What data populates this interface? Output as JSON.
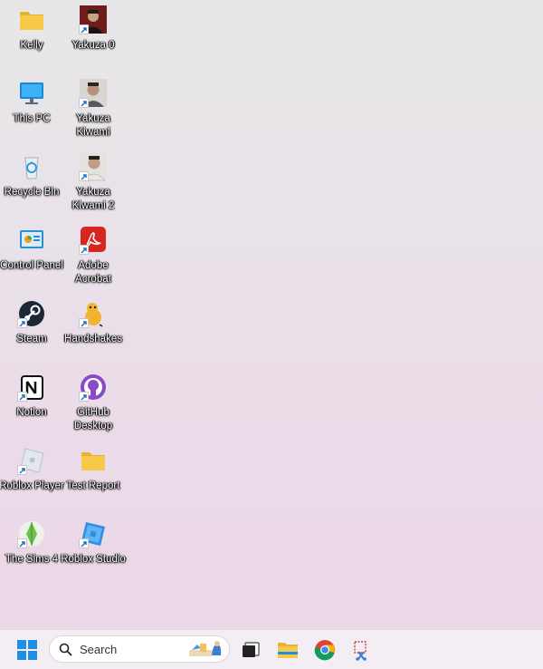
{
  "desktop": {
    "icons": [
      {
        "label": "Kelly",
        "icon": "folder-icon"
      },
      {
        "label": "Yakuza 0",
        "icon": "yakuza-0-icon"
      },
      {
        "label": "This PC",
        "icon": "monitor-icon"
      },
      {
        "label": "Yakuza Kiwami",
        "icon": "yakuza-kiwami-icon"
      },
      {
        "label": "Recycle Bin",
        "icon": "recycle-bin-icon"
      },
      {
        "label": "Yakuza Kiwami 2",
        "icon": "yakuza-kiwami-2-icon"
      },
      {
        "label": "Control Panel",
        "icon": "control-panel-icon"
      },
      {
        "label": "Adobe Acrobat",
        "icon": "adobe-acrobat-icon"
      },
      {
        "label": "Steam",
        "icon": "steam-icon"
      },
      {
        "label": "Handshakes",
        "icon": "handshakes-icon"
      },
      {
        "label": "Notion",
        "icon": "notion-icon"
      },
      {
        "label": "GitHub Desktop",
        "icon": "github-desktop-icon"
      },
      {
        "label": "Roblox Player",
        "icon": "roblox-player-icon"
      },
      {
        "label": "Test Report",
        "icon": "folder-icon"
      },
      {
        "label": "The Sims 4",
        "icon": "sims-4-icon"
      },
      {
        "label": "Roblox Studio",
        "icon": "roblox-studio-icon"
      }
    ]
  },
  "taskbar": {
    "search_placeholder": "Search",
    "apps": [
      {
        "icon": "windows-start-icon"
      },
      {
        "icon": "task-view-icon"
      },
      {
        "icon": "file-explorer-icon"
      },
      {
        "icon": "chrome-icon"
      },
      {
        "icon": "snipping-tool-icon"
      }
    ]
  },
  "colors": {
    "folder": "#f7c94a",
    "accent": "#0078d4",
    "acrobat": "#d7261f",
    "steam": "#1b2838"
  }
}
